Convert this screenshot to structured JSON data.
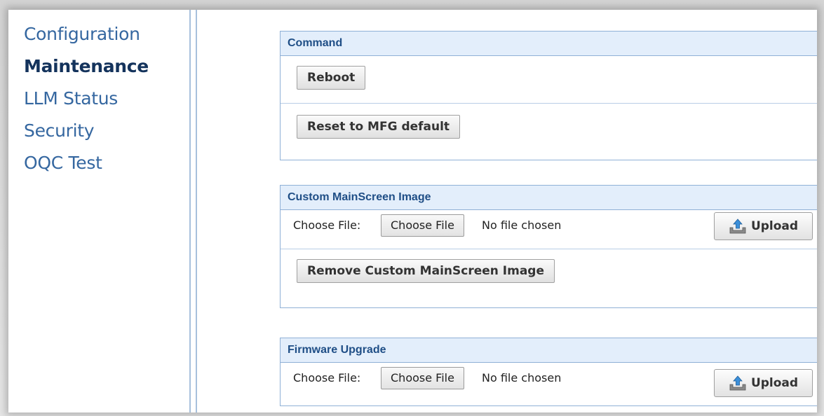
{
  "nav": {
    "items": [
      {
        "label": "Configuration",
        "active": false
      },
      {
        "label": "Maintenance",
        "active": true
      },
      {
        "label": "LLM Status",
        "active": false
      },
      {
        "label": "Security",
        "active": false
      },
      {
        "label": "OQC Test",
        "active": false
      }
    ]
  },
  "command": {
    "title": "Command",
    "reboot_label": "Reboot",
    "reset_label": "Reset to MFG default"
  },
  "custom_image": {
    "title": "Custom MainScreen Image",
    "file_label": "Choose File:",
    "choose_label": "Choose File",
    "status": "No file chosen",
    "upload_label": "Upload",
    "remove_label": "Remove Custom MainScreen Image"
  },
  "firmware": {
    "title": "Firmware Upgrade",
    "file_label": "Choose File:",
    "choose_label": "Choose File",
    "status": "No file chosen",
    "upload_label": "Upload"
  },
  "colors": {
    "nav_link": "#3567a0",
    "nav_active": "#14335c",
    "panel_header_bg": "#e3eefb",
    "panel_border": "#8fb0d6"
  },
  "icons": {
    "upload": "upload-tray-icon"
  }
}
